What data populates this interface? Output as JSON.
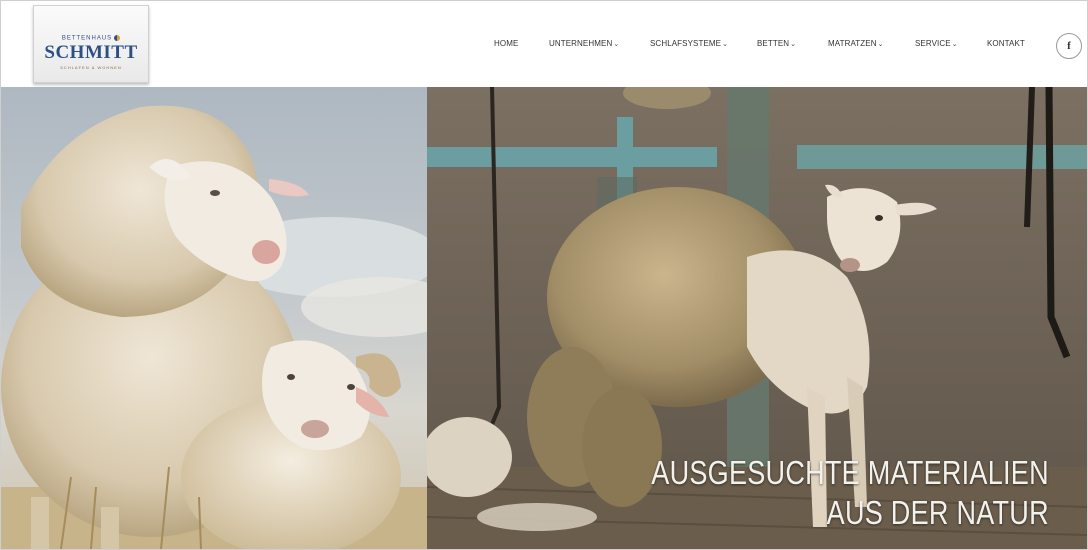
{
  "header": {
    "logo": {
      "top_text": "BETTENHAUS",
      "main_text": "SCHMITT",
      "sub_text": "SCHLAFEN & WOHNEN"
    },
    "nav": [
      {
        "label": "HOME",
        "dropdown": false
      },
      {
        "label": "UNTERNEHMEN",
        "dropdown": true
      },
      {
        "label": "SCHLAFSYSTEME",
        "dropdown": true
      },
      {
        "label": "BETTEN",
        "dropdown": true
      },
      {
        "label": "MATRATZEN",
        "dropdown": true
      },
      {
        "label": "SERVICE",
        "dropdown": true
      },
      {
        "label": "KONTAKT",
        "dropdown": false
      }
    ],
    "social": {
      "facebook_label": "f",
      "icon": "facebook-icon"
    }
  },
  "hero": {
    "headline_line1": "AUSGESUCHTE MATERIALIEN",
    "headline_line2": "AUS DER NATUR"
  },
  "colors": {
    "brand_blue": "#2d4f86",
    "nav_text": "#333333",
    "headline_text": "#f3f1ec"
  }
}
